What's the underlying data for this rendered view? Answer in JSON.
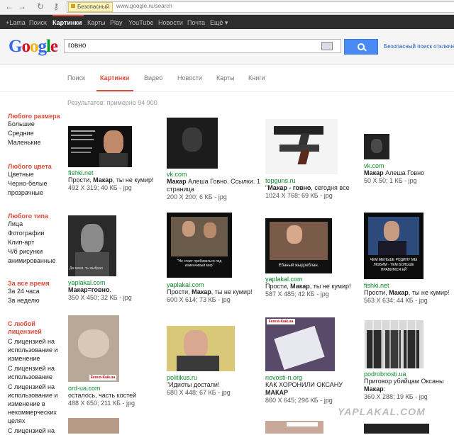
{
  "browser": {
    "security_label": "Безопасный",
    "url": "www.google.ru/search"
  },
  "gbar": {
    "items": [
      "+Lama",
      "Поиск",
      "Картинки",
      "Карты",
      "Play",
      "YouTube",
      "Новости",
      "Почта",
      "Ещё ▾"
    ]
  },
  "header": {
    "logo": "Google",
    "query": "говно",
    "safe_search": "Безопасный поиск отключен"
  },
  "tabs": [
    "Поиск",
    "Картинки",
    "Видео",
    "Новости",
    "Карты",
    "Книги"
  ],
  "result_stats": "Результатов: примерно 94 900",
  "filters": {
    "size": {
      "heading": "Любого размера",
      "items": [
        "Большие",
        "Средние",
        "Маленькие"
      ]
    },
    "color": {
      "heading": "Любого цвета",
      "items": [
        "Цветные",
        "Черно-белые",
        "прозрачные"
      ]
    },
    "type": {
      "heading": "Любого типа",
      "items": [
        "Лица",
        "Фотографии",
        "Клип-арт",
        "Ч/б рисунки",
        "анимированные"
      ]
    },
    "time": {
      "heading": "За все время",
      "items": [
        "За 24 часа",
        "За неделю"
      ]
    },
    "license": {
      "heading": "С любой лицензией",
      "items": [
        "С лицензией на использование и изменение",
        "С лицензией на использование",
        "С лицензией на использование и изменение в некоммерческих целях",
        "С лицензией на"
      ]
    }
  },
  "results": [
    {
      "source": "fishki.net",
      "title_pre": "Прости, ",
      "title_bold": "Макар",
      "title_post": ", ты не кумир!",
      "meta": "492 X 319; 40 КБ - jpg"
    },
    {
      "source": "vk.com",
      "title_pre": "",
      "title_bold": "Макар",
      "title_post": " Алеша Говно. Ссылки. 1 страница",
      "meta": "200 X 200; 6 КБ - jpg"
    },
    {
      "source": "topguns.ru",
      "title_pre": "\"",
      "title_bold": "Макар - говно",
      "title_post": ", сегодня все",
      "meta": "1024 X 768; 69 КБ - jpg"
    },
    {
      "source": "vk.com",
      "title_pre": "",
      "title_bold": "Макар",
      "title_post": " Алеша Говно",
      "meta": "50 X 50; 1 КБ - jpg"
    },
    {
      "source": "yaplakal.com",
      "title_pre": "",
      "title_bold": "Макар=говно",
      "title_post": ".",
      "meta": "350 X 450; 32 КБ - jpg"
    },
    {
      "source": "yaplakal.com",
      "title_pre": "Прости, ",
      "title_bold": "Макар",
      "title_post": ", ты не кумир!",
      "meta": "600 X 614; 73 КБ - jpg"
    },
    {
      "source": "yaplakal.com",
      "title_pre": "Прости, ",
      "title_bold": "Макар",
      "title_post": ", ты не кумир!",
      "meta": "587 X 485; 42 КБ - jpg"
    },
    {
      "source": "fishki.net",
      "title_pre": "Прости, ",
      "title_bold": "Макар",
      "title_post": ", ты не кумир!",
      "meta": "563 X 634; 44 КБ - jpg"
    },
    {
      "source": "ord-ua.com",
      "title_pre": "осталось, часть костей",
      "title_bold": "",
      "title_post": "",
      "meta": "488 X 650; 211 КБ - jpg"
    },
    {
      "source": "politikus.ru",
      "title_pre": "\"Идиоты достали!",
      "title_bold": "",
      "title_post": "",
      "meta": "680 X 448; 67 КБ - jpg"
    },
    {
      "source": "novosti-n.org",
      "title_pre": "КАК ХОРОНИЛИ ОКСАНУ ",
      "title_bold": "МАКАР",
      "title_post": "",
      "meta": "860 X 645; 296 КБ - jpg"
    },
    {
      "source": "podrobnosti.ua",
      "title_pre": "Приговор убийцам Оксаны ",
      "title_bold": "Макар",
      "title_post": ":",
      "meta": "360 X 288; 19 КБ - jpg"
    }
  ],
  "thumb_text": {
    "stalin_caption": "Да меня, ты выбрал",
    "meme2_caption": "\"Не стоит пробиваться под изменчивый мир\"",
    "meme3_caption": "Ебаный жыдоеблан.",
    "meme4_caption": "ЧЕМ МЕНЬШЕ РОДИНУ МЫ ЛЮБИМ - ТЕМ БОЛЬШЕ НРАВИМСЯ ЕЙ",
    "stamp": "Ferest-Kaik.ua"
  },
  "watermark": "YAPLAKAL.COM",
  "colors": {
    "accent": "#dd4b39",
    "link_green": "#0a8a28",
    "search_button": "#4a8af4"
  }
}
